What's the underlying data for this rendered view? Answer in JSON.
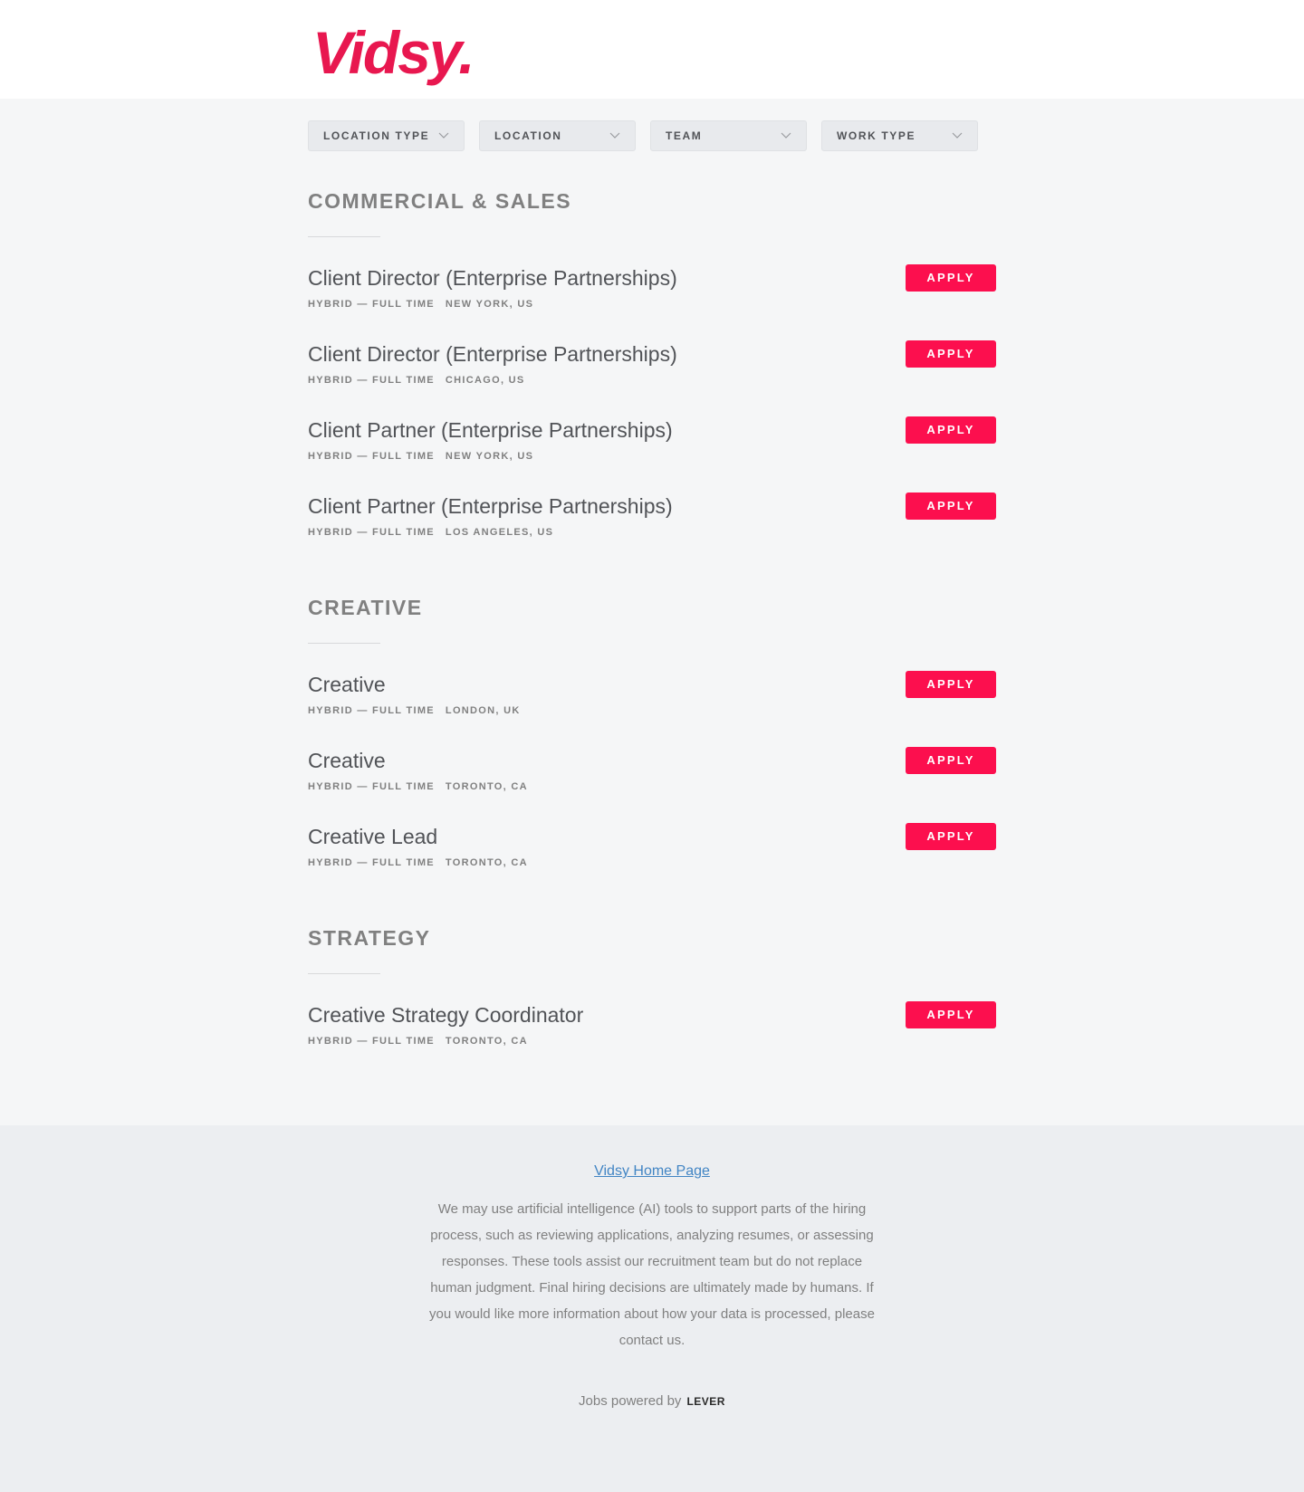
{
  "brand": {
    "logo_text": "Vidsy.",
    "accent": "#fc0f4e",
    "logo_color": "#e8174f"
  },
  "filters": [
    {
      "label": "LOCATION TYPE",
      "icon": "chevron-down-icon"
    },
    {
      "label": "LOCATION",
      "icon": "chevron-down-icon"
    },
    {
      "label": "TEAM",
      "icon": "chevron-down-icon"
    },
    {
      "label": "WORK TYPE",
      "icon": "chevron-down-icon"
    }
  ],
  "groups": [
    {
      "title": "COMMERCIAL & SALES",
      "postings": [
        {
          "title": "Client Director (Enterprise Partnerships)",
          "commitment": "HYBRID — FULL TIME",
          "location": "NEW YORK, US",
          "apply": "APPLY"
        },
        {
          "title": "Client Director (Enterprise Partnerships)",
          "commitment": "HYBRID — FULL TIME",
          "location": "CHICAGO, US",
          "apply": "APPLY"
        },
        {
          "title": "Client Partner (Enterprise Partnerships)",
          "commitment": "HYBRID — FULL TIME",
          "location": "NEW YORK, US",
          "apply": "APPLY"
        },
        {
          "title": "Client Partner (Enterprise Partnerships)",
          "commitment": "HYBRID — FULL TIME",
          "location": "LOS ANGELES, US",
          "apply": "APPLY"
        }
      ]
    },
    {
      "title": "CREATIVE",
      "postings": [
        {
          "title": "Creative",
          "commitment": "HYBRID — FULL TIME",
          "location": "LONDON, UK",
          "apply": "APPLY"
        },
        {
          "title": "Creative",
          "commitment": "HYBRID — FULL TIME",
          "location": "TORONTO, CA",
          "apply": "APPLY"
        },
        {
          "title": "Creative Lead",
          "commitment": "HYBRID — FULL TIME",
          "location": "TORONTO, CA",
          "apply": "APPLY"
        }
      ]
    },
    {
      "title": "STRATEGY",
      "postings": [
        {
          "title": "Creative Strategy Coordinator",
          "commitment": "HYBRID — FULL TIME",
          "location": "TORONTO, CA",
          "apply": "APPLY"
        }
      ]
    }
  ],
  "footer": {
    "home_link": "Vidsy Home Page",
    "ai_note": "We may use artificial intelligence (AI) tools to support parts of the hiring process, such as reviewing applications, analyzing resumes, or assessing responses. These tools assist our recruitment team but do not replace human judgment. Final hiring decisions are ultimately made by humans. If you would like more information about how your data is processed, please contact us.",
    "powered_by": "Jobs powered by",
    "powered_brand": "LEVER"
  }
}
